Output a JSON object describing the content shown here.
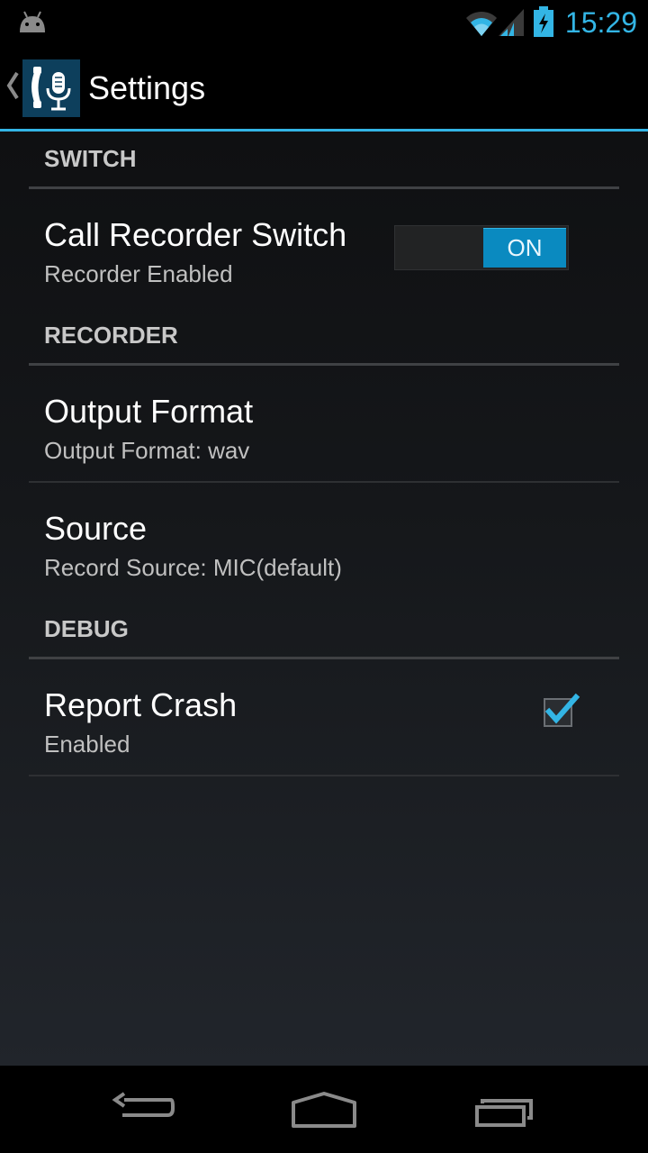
{
  "status_bar": {
    "time": "15:29",
    "icons": [
      "android-notification-icon",
      "wifi-icon",
      "signal-icon",
      "battery-charging-icon"
    ],
    "accent_color": "#33b5e5"
  },
  "action_bar": {
    "title": "Settings",
    "icons": [
      "back-chevron-icon",
      "call-recorder-app-icon"
    ]
  },
  "categories": {
    "switch": "SWITCH",
    "recorder": "RECORDER",
    "debug": "DEBUG"
  },
  "preferences": {
    "call_recorder_switch": {
      "title": "Call Recorder Switch",
      "summary": "Recorder Enabled",
      "state": "ON"
    },
    "output_format": {
      "title": "Output Format",
      "summary": "Output Format: wav"
    },
    "source": {
      "title": "Source",
      "summary": "Record Source: MIC(default)"
    },
    "report_crash": {
      "title": "Report Crash",
      "summary": "Enabled",
      "checked": true
    }
  },
  "nav_bar": {
    "icons": [
      "back-icon",
      "home-icon",
      "recent-apps-icon"
    ]
  }
}
